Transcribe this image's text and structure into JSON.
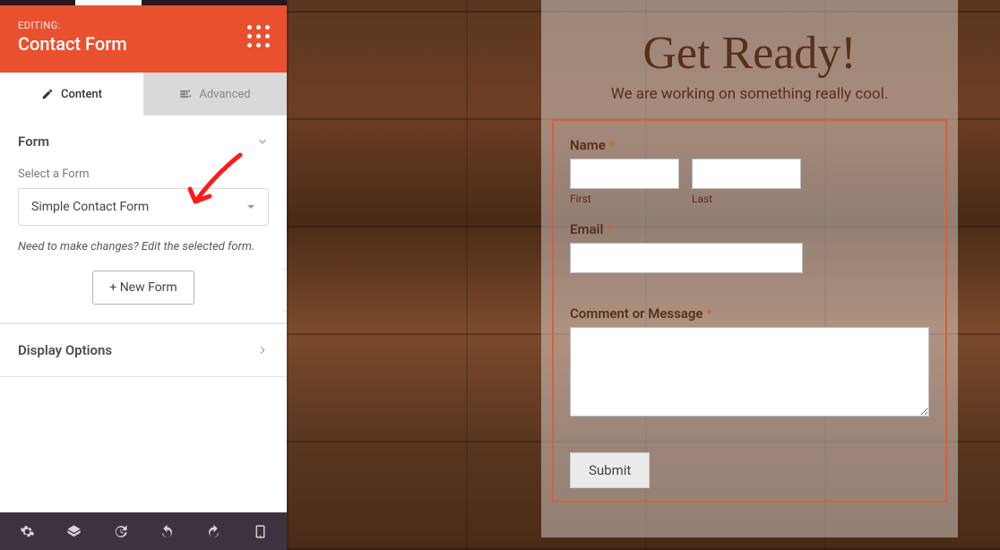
{
  "header": {
    "editing": "EDITING:",
    "title": "Contact Form"
  },
  "tabs": {
    "content": "Content",
    "advanced": "Advanced"
  },
  "form_section": {
    "title": "Form",
    "select_label": "Select a Form",
    "selected": "Simple Contact Form",
    "hint": "Need to make changes? Edit the selected form.",
    "new_form": "+ New Form"
  },
  "display_section": {
    "title": "Display Options"
  },
  "preview": {
    "title": "Get Ready!",
    "subtitle": "We are working on something really cool.",
    "name_label": "Name",
    "first": "First",
    "last": "Last",
    "email_label": "Email",
    "comment_label": "Comment or Message",
    "submit": "Submit"
  }
}
